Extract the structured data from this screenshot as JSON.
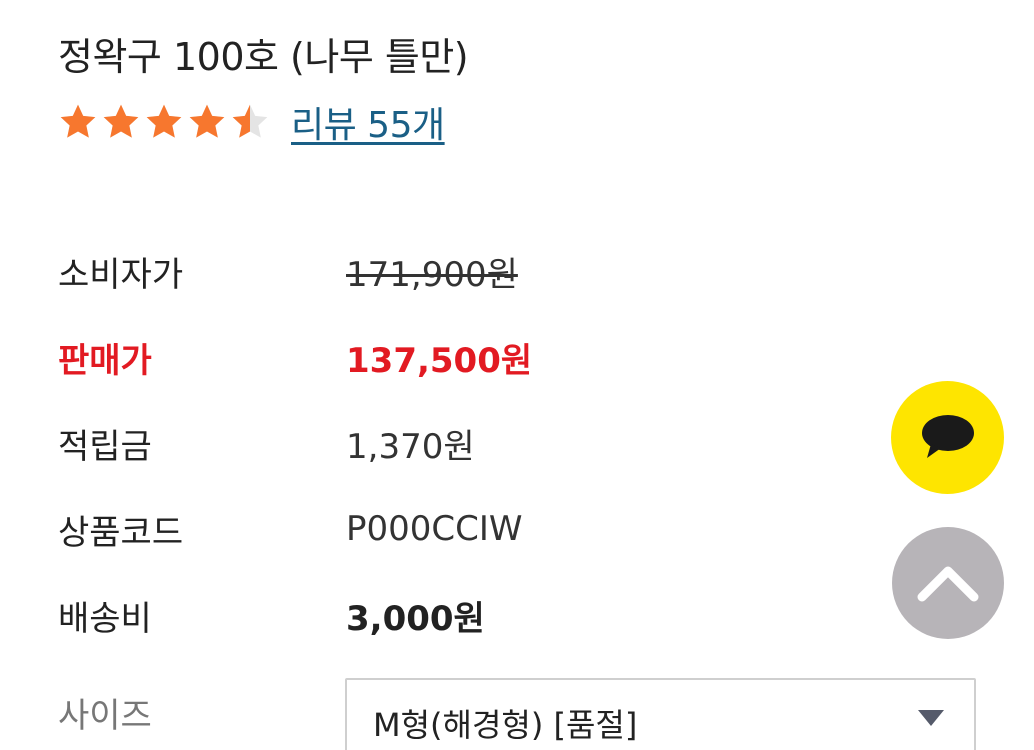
{
  "product": {
    "title": "정왁구 100호 (나무 틀만)",
    "rating": 4.5,
    "rating_max": 5,
    "review_link": "리뷰 55개"
  },
  "info": {
    "retail_price_label": "소비자가",
    "retail_price_value": "171,900원",
    "sale_price_label": "판매가",
    "sale_price_value": "137,500원",
    "points_label": "적립금",
    "points_value": "1,370원",
    "product_code_label": "상품코드",
    "product_code_value": "P000CCIW",
    "shipping_label": "배송비",
    "shipping_value": "3,000원"
  },
  "options": {
    "size_label": "사이즈",
    "size_selected": "M형(해경형) [품절]"
  },
  "floating": {
    "chat_icon": "kakao-chat-icon",
    "top_icon": "chevron-up-icon"
  },
  "colors": {
    "star": "#f7772e",
    "star_empty": "#e4e4e4",
    "sale": "#e21a22",
    "link": "#1a5f86",
    "kakao": "#fee500",
    "top_button": "#b7b4b8"
  }
}
